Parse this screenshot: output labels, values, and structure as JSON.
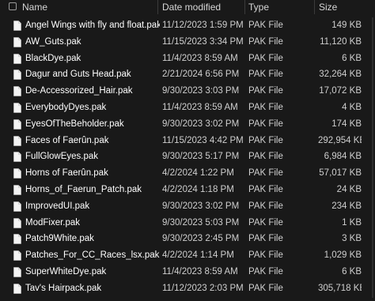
{
  "columns": {
    "name": "Name",
    "date": "Date modified",
    "type": "Type",
    "size": "Size"
  },
  "files": [
    {
      "name": "Angel Wings with fly and float.pak",
      "date": "11/12/2023 1:59 PM",
      "type": "PAK File",
      "size": "149 KB"
    },
    {
      "name": "AW_Guts.pak",
      "date": "11/15/2023 3:34 PM",
      "type": "PAK File",
      "size": "11,120 KB"
    },
    {
      "name": "BlackDye.pak",
      "date": "11/4/2023 8:59 AM",
      "type": "PAK File",
      "size": "6 KB"
    },
    {
      "name": "Dagur and Guts Head.pak",
      "date": "2/21/2024 6:56 PM",
      "type": "PAK File",
      "size": "32,264 KB"
    },
    {
      "name": "De-Accessorized_Hair.pak",
      "date": "9/30/2023 3:03 PM",
      "type": "PAK File",
      "size": "17,072 KB"
    },
    {
      "name": "EverybodyDyes.pak",
      "date": "11/4/2023 8:59 AM",
      "type": "PAK File",
      "size": "4 KB"
    },
    {
      "name": "EyesOfTheBeholder.pak",
      "date": "9/30/2023 3:02 PM",
      "type": "PAK File",
      "size": "174 KB"
    },
    {
      "name": "Faces of Faerûn.pak",
      "date": "11/15/2023 4:42 PM",
      "type": "PAK File",
      "size": "292,954 KB"
    },
    {
      "name": "FullGlowEyes.pak",
      "date": "9/30/2023 5:17 PM",
      "type": "PAK File",
      "size": "6,984 KB"
    },
    {
      "name": "Horns of Faerûn.pak",
      "date": "4/2/2024 1:22 PM",
      "type": "PAK File",
      "size": "57,017 KB"
    },
    {
      "name": "Horns_of_Faerun_Patch.pak",
      "date": "4/2/2024 1:18 PM",
      "type": "PAK File",
      "size": "24 KB"
    },
    {
      "name": "ImprovedUI.pak",
      "date": "9/30/2023 3:02 PM",
      "type": "PAK File",
      "size": "234 KB"
    },
    {
      "name": "ModFixer.pak",
      "date": "9/30/2023 5:03 PM",
      "type": "PAK File",
      "size": "1 KB"
    },
    {
      "name": "Patch9White.pak",
      "date": "9/30/2023 2:45 PM",
      "type": "PAK File",
      "size": "3 KB"
    },
    {
      "name": "Patches_For_CC_Races_lsx.pak",
      "date": "4/2/2024 1:14 PM",
      "type": "PAK File",
      "size": "1,029 KB"
    },
    {
      "name": "SuperWhiteDye.pak",
      "date": "11/4/2023 8:59 AM",
      "type": "PAK File",
      "size": "6 KB"
    },
    {
      "name": "Tav's Hairpack.pak",
      "date": "11/12/2023 2:03 PM",
      "type": "PAK File",
      "size": "305,718 KB"
    }
  ]
}
